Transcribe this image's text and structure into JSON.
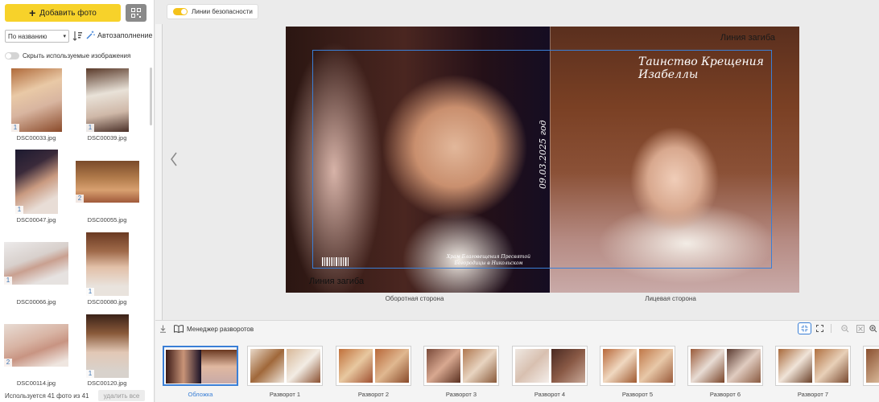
{
  "sidebar": {
    "add_photo_label": "Добавить фото",
    "sort_value": "По названию",
    "autofill_label": "Автозаполнение",
    "hide_used_label": "Скрыть используемые изображения",
    "photos": [
      {
        "name": "DSC00033.jpg",
        "count": "1"
      },
      {
        "name": "DSC00039.jpg",
        "count": "1"
      },
      {
        "name": "DSC00047.jpg",
        "count": "1"
      },
      {
        "name": "DSC00055.jpg",
        "count": "2"
      },
      {
        "name": "DSC00066.jpg",
        "count": "1"
      },
      {
        "name": "DSC00080.jpg",
        "count": "1"
      },
      {
        "name": "DSC00114.jpg",
        "count": "2"
      },
      {
        "name": "DSC00120.jpg",
        "count": "1"
      }
    ],
    "used_count_text": "Используется 41 фото из 41",
    "delete_all_label": "удалить все"
  },
  "toolbar": {
    "safety_lines_label": "Линии безопасности"
  },
  "cover": {
    "fold_line_top": "Линия загиба",
    "fold_line_bottom": "Линия загиба",
    "title_text": "Таинство Крещения Изабеллы",
    "date_text": "09.03.2025 год",
    "small_text": "Храм Благовещения Пресвятой Богородицы в Никольском",
    "back_caption": "Оборотная сторона",
    "front_caption": "Лицевая сторона"
  },
  "strip": {
    "manager_label": "Менеджер разворотов",
    "spreads": [
      {
        "label": "Обложка"
      },
      {
        "label": "Разворот 1"
      },
      {
        "label": "Разворот 2"
      },
      {
        "label": "Разворот 3"
      },
      {
        "label": "Разворот 4"
      },
      {
        "label": "Разворот 5"
      },
      {
        "label": "Разворот 6"
      },
      {
        "label": "Разворот 7"
      }
    ]
  },
  "colors": {
    "accent_yellow": "#f7d22a",
    "selection_blue": "#3a7fd6"
  }
}
